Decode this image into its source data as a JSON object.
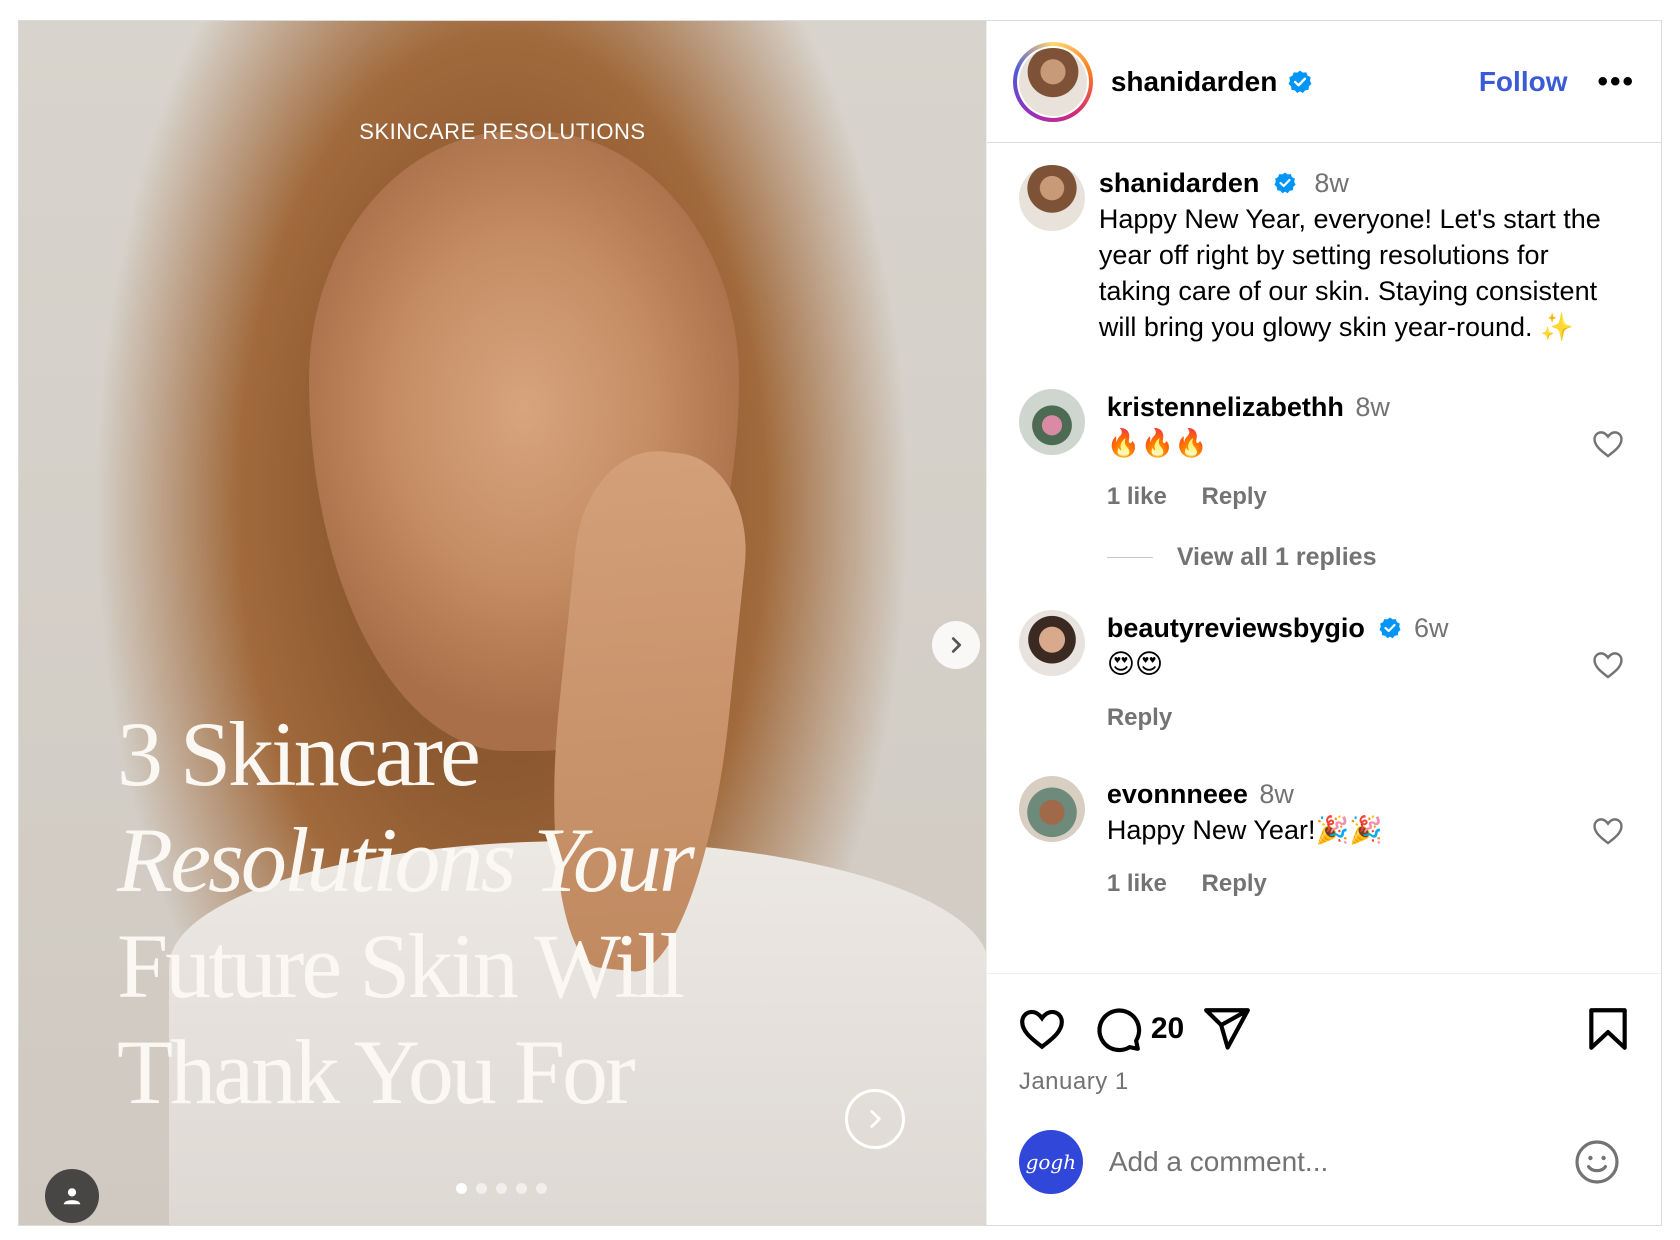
{
  "header": {
    "username": "shanidarden",
    "follow_label": "Follow",
    "more_label": "•••"
  },
  "media": {
    "overlay_label": "SKINCARE RESOLUTIONS",
    "headline_lines": [
      "3 Skincare",
      "Resolutions Your",
      "Future Skin Will",
      "Thank You For"
    ],
    "slide_count": 5,
    "active_slide": 1
  },
  "caption": {
    "username": "shanidarden",
    "time": "8w",
    "text": "Happy New Year, everyone! Let's start the year off right by setting resolutions for taking care of our skin. Staying consistent will bring you glowy skin year-round. ✨"
  },
  "comments": [
    {
      "username": "kristennelizabethh",
      "time": "8w",
      "text": "🔥🔥🔥",
      "likes": "1 like",
      "reply_label": "Reply",
      "verified": false
    },
    {
      "username": "beautyreviewsbygio",
      "time": "6w",
      "text": "😍😍",
      "likes": "",
      "reply_label": "Reply",
      "verified": true
    },
    {
      "username": "evonnneee",
      "time": "8w",
      "text": "Happy New Year!🎉🎉",
      "likes": "1 like",
      "reply_label": "Reply",
      "verified": false
    }
  ],
  "view_replies_label": "View all 1 replies",
  "actions": {
    "comment_count": "20",
    "date": "January 1"
  },
  "add_comment": {
    "placeholder": "Add a comment...",
    "avatar_text": "gogh"
  },
  "colors": {
    "follow": "#3b5bd6",
    "verified": "#0095f6",
    "muted": "#737373",
    "border": "#dbdbdb"
  }
}
